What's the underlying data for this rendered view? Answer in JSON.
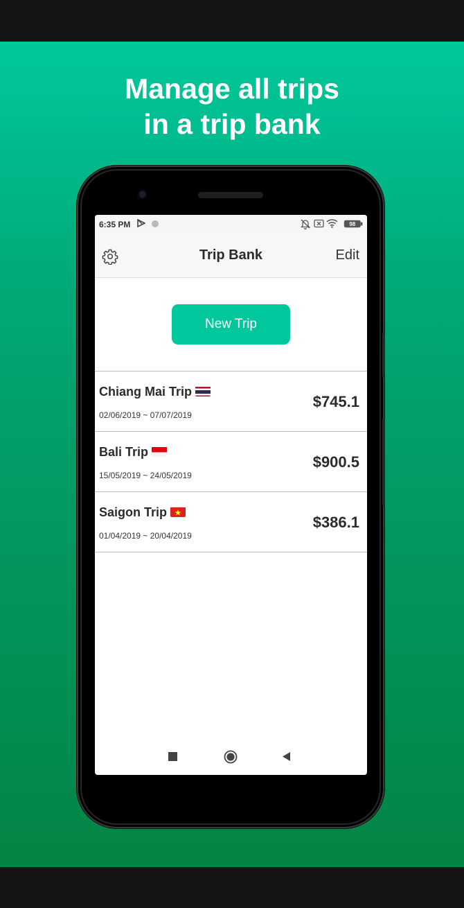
{
  "promo": {
    "headline_line1": "Manage all trips",
    "headline_line2": "in a trip bank"
  },
  "colors": {
    "accent": "#00c89c",
    "gradient_top": "#00c89c",
    "gradient_bottom": "#038444"
  },
  "status_bar": {
    "time": "6:35 PM",
    "left_icons": [
      "play-store-notification-icon",
      "dot-notification-icon"
    ],
    "right_icons": [
      "bell-off-icon",
      "x-box-icon",
      "wifi-icon",
      "battery-icon"
    ],
    "battery_level": "98"
  },
  "app_bar": {
    "settings_icon": "gear-icon",
    "title": "Trip Bank",
    "edit_label": "Edit"
  },
  "new_trip_label": "New Trip",
  "trips": [
    {
      "name": "Chiang Mai Trip",
      "flag": "Thailand",
      "dates": "02/06/2019 ~ 07/07/2019",
      "amount": "$745.1"
    },
    {
      "name": "Bali Trip",
      "flag": "Indonesia",
      "dates": "15/05/2019 ~ 24/05/2019",
      "amount": "$900.5"
    },
    {
      "name": "Saigon Trip",
      "flag": "Vietnam",
      "dates": "01/04/2019 ~ 20/04/2019",
      "amount": "$386.1"
    }
  ],
  "nav_bar": {
    "icons": [
      "recents-square-icon",
      "home-circle-icon",
      "back-triangle-icon"
    ]
  }
}
